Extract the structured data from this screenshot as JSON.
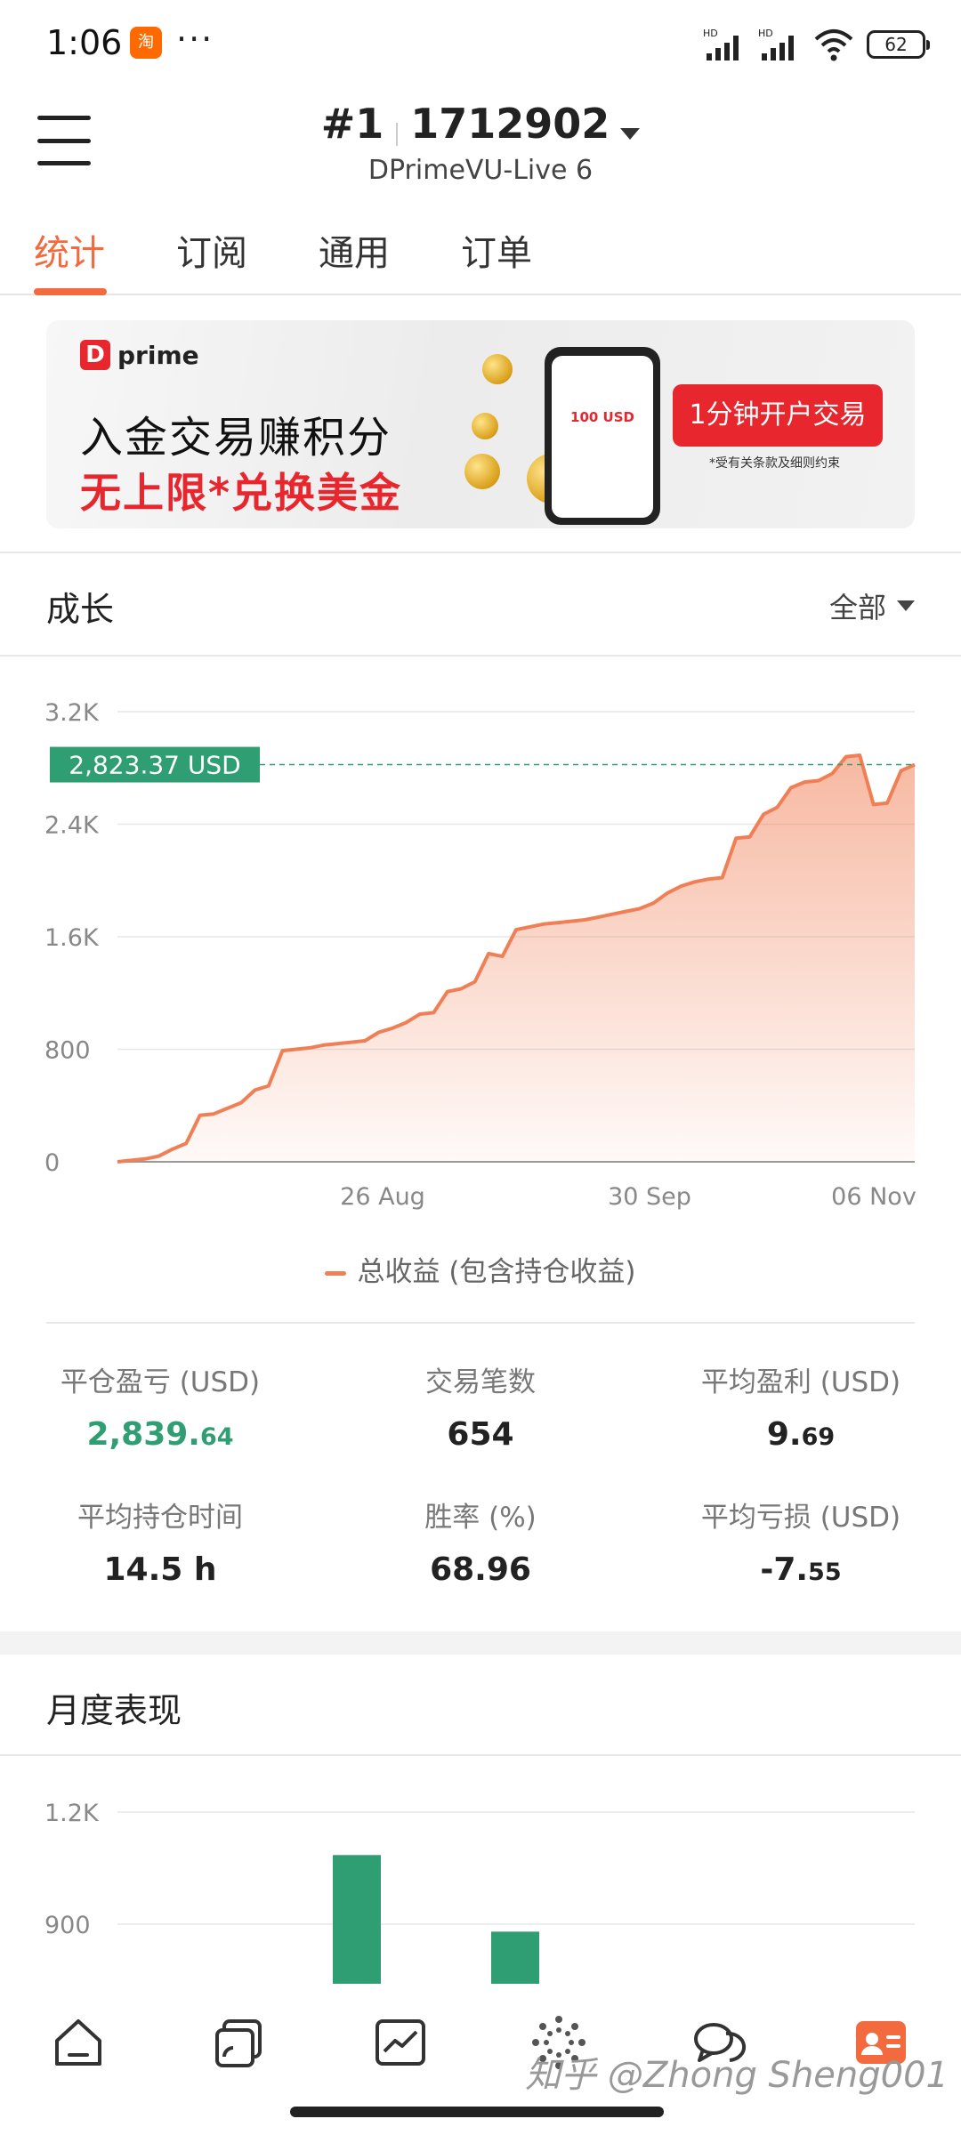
{
  "status_bar": {
    "time": "1:06",
    "app_badge": "淘",
    "more": "···",
    "signal1": "HD",
    "signal2": "HD",
    "battery": "62"
  },
  "header": {
    "account_rank": "#1",
    "account_number": "1712902",
    "server": "DPrimeVU-Live 6"
  },
  "tabs": [
    {
      "label": "统计",
      "active": true
    },
    {
      "label": "订阅",
      "active": false
    },
    {
      "label": "通用",
      "active": false
    },
    {
      "label": "订单",
      "active": false
    }
  ],
  "banner": {
    "logo": "prime",
    "line1": "入金交易赚积分",
    "line2": "无上限*兑换美金",
    "phone_promo": "100 USD",
    "cta": "1分钟开户交易",
    "terms": "*受有关条款及细则约束"
  },
  "growth": {
    "title": "成长",
    "filter": "全部",
    "legend": "总收益 (包含持仓收益)"
  },
  "chart_data": [
    {
      "type": "area",
      "title": "成长",
      "series": [
        {
          "name": "总收益 (包含持仓收益)",
          "color": "#f07f55"
        }
      ],
      "y_ticks": [
        "3.2K",
        "2.4K",
        "1.6K",
        "800",
        "0"
      ],
      "ylim": [
        0,
        3200
      ],
      "x_ticks": [
        "26 Aug",
        "30 Sep",
        "06 Nov"
      ],
      "current_value_label": "2,823.37 USD",
      "current_value": 2823.37,
      "values": [
        0,
        10,
        20,
        40,
        90,
        130,
        330,
        340,
        380,
        420,
        510,
        540,
        790,
        800,
        810,
        830,
        840,
        850,
        860,
        920,
        950,
        990,
        1050,
        1060,
        1210,
        1230,
        1280,
        1480,
        1460,
        1650,
        1670,
        1690,
        1700,
        1710,
        1720,
        1740,
        1760,
        1780,
        1800,
        1840,
        1910,
        1960,
        1990,
        2010,
        2020,
        2300,
        2310,
        2470,
        2520,
        2660,
        2700,
        2710,
        2760,
        2880,
        2890,
        2540,
        2550,
        2780,
        2823.37
      ],
      "grid": true
    },
    {
      "type": "bar",
      "title": "月度表现",
      "y_ticks": [
        "1.2K",
        "900"
      ],
      "ylim": [
        0,
        1200
      ],
      "bars": [
        {
          "value": 1085,
          "color": "#2f9e72"
        },
        {
          "value": 880,
          "color": "#2f9e72"
        }
      ],
      "grid": true
    }
  ],
  "stats": {
    "closed_pl_label": "平仓盈亏 (USD)",
    "closed_pl_int": "2,839.",
    "closed_pl_dec": "64",
    "trades_label": "交易笔数",
    "trades_value": "654",
    "avg_profit_label": "平均盈利 (USD)",
    "avg_profit_int": "9.",
    "avg_profit_dec": "69",
    "avg_hold_label": "平均持仓时间",
    "avg_hold_value": "14.5 h",
    "win_rate_label": "胜率 (%)",
    "win_rate_value": "68.96",
    "avg_loss_label": "平均亏损 (USD)",
    "avg_loss_int": "-7.",
    "avg_loss_dec": "55"
  },
  "monthly": {
    "title": "月度表现"
  },
  "bottom_nav": [
    "home-icon",
    "cards-icon",
    "chart-icon",
    "discover-icon",
    "chat-icon",
    "profile-icon"
  ],
  "watermark": "知乎 @Zhong Sheng001",
  "colors": {
    "accent": "#f26a3d",
    "line": "#f07f55",
    "profit": "#2f9e72",
    "price_tag": "#2f9e72"
  }
}
